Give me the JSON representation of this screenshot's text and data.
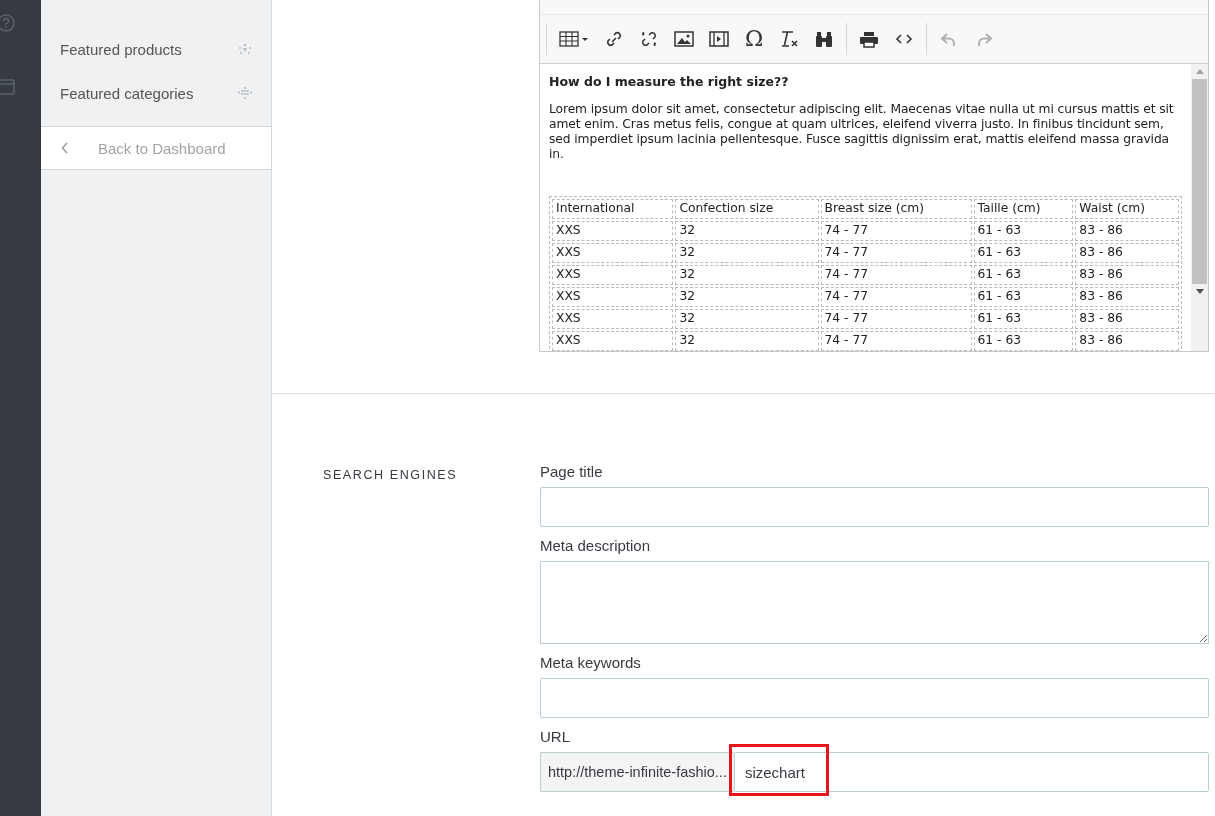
{
  "sidebar": {
    "items": [
      {
        "label": "Featured products"
      },
      {
        "label": "Featured categories"
      }
    ],
    "back_link": "Back to Dashboard"
  },
  "editor": {
    "undo_disabled": true,
    "redo_disabled": true,
    "special_char": "Ω",
    "heading": "How do I measure the right size??",
    "paragraph": "Lorem ipsum dolor sit amet, consectetur adipiscing elit. Maecenas vitae nulla ut mi cursus mattis et sit amet enim. Cras metus felis, congue at quam ultrices, eleifend viverra justo. In finibus tincidunt sem, sed imperdiet ipsum lacinia pellentesque. Fusce sagittis dignissim erat, mattis eleifend massa gravida in.",
    "table": {
      "columns": [
        "International",
        "Confection size",
        "Breast size (cm)",
        "Taille (cm)",
        "Waist (cm)"
      ],
      "rows": [
        [
          "XXS",
          "32",
          "74 - 77",
          "61 - 63",
          "83 - 86"
        ],
        [
          "XXS",
          "32",
          "74 - 77",
          "61 - 63",
          "83 - 86"
        ],
        [
          "XXS",
          "32",
          "74 - 77",
          "61 - 63",
          "83 - 86"
        ],
        [
          "XXS",
          "32",
          "74 - 77",
          "61 - 63",
          "83 - 86"
        ],
        [
          "XXS",
          "32",
          "74 - 77",
          "61 - 63",
          "83 - 86"
        ],
        [
          "XXS",
          "32",
          "74 - 77",
          "61 - 63",
          "83 - 86"
        ]
      ]
    }
  },
  "search_engines": {
    "title": "SEARCH ENGINES",
    "fields": [
      {
        "kind": "input",
        "label": "Page title"
      },
      {
        "kind": "textarea",
        "label": "Meta description"
      },
      {
        "kind": "input",
        "label": "Meta keywords"
      },
      {
        "kind": "url",
        "label": "URL",
        "prefix": "http://theme-infinite-fashio...",
        "value": "sizechart",
        "highlighted": true
      }
    ]
  }
}
